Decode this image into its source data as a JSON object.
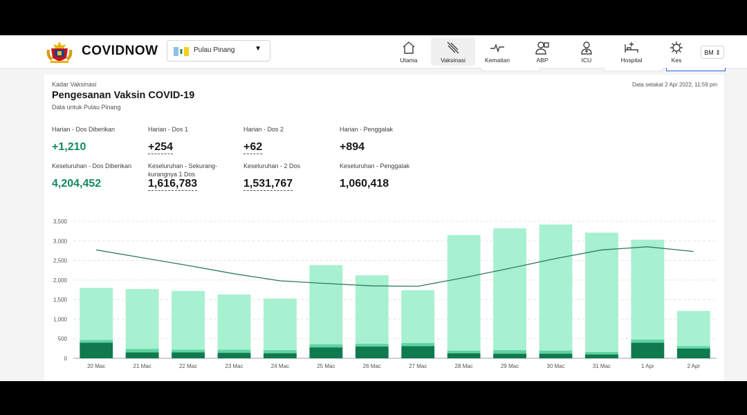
{
  "header": {
    "brand": "COVIDNOW",
    "state_label": "Pulau Pinang",
    "nav": [
      {
        "label": "Utama",
        "icon": "home-icon",
        "active": false
      },
      {
        "label": "Vaksinasi",
        "icon": "syringe-icon",
        "active": true
      },
      {
        "label": "Kematian",
        "icon": "pulse-icon",
        "active": false
      },
      {
        "label": "ABP",
        "icon": "patients-icon",
        "active": false
      },
      {
        "label": "ICU",
        "icon": "icu-icon",
        "active": false
      },
      {
        "label": "Hospital",
        "icon": "hospital-bed-icon",
        "active": false
      },
      {
        "label": "Kes",
        "icon": "virus-icon",
        "active": false
      }
    ],
    "language": "BM ⇕"
  },
  "card": {
    "kicker": "Kadar Vaksinasi",
    "title": "Pengesanan Vaksin COVID-19",
    "subtitle": "Data untuk Pulau Pinang",
    "updated": "Data setakat 2 Apr 2022, 11:59 pm"
  },
  "stats": [
    {
      "daily_label": "Harian - Dos Diberikan",
      "daily_value": "+1,210",
      "total_label": "Keseluruhan - Dos Diberikan",
      "total_value": "4,204,452"
    },
    {
      "daily_label": "Harian - Dos 1",
      "daily_value": "+254",
      "total_label": "Keseluruhan - Sekurang-kurangnya 1 Dos",
      "total_value": "1,616,783"
    },
    {
      "daily_label": "Harian - Dos 2",
      "daily_value": "+62",
      "total_label": "Keseluruhan - 2 Dos",
      "total_value": "1,531,767"
    },
    {
      "daily_label": "Harian - Penggalak",
      "daily_value": "+894",
      "total_label": "Keseluruhan - Penggalak",
      "total_value": "1,060,418"
    }
  ],
  "colors": {
    "accent": "#138a5b",
    "bar_light": "#a7f0d1",
    "bar_mid": "#5fd3a2",
    "bar_dark": "#0f7a4f",
    "line": "#2f7a56"
  },
  "chart_data": {
    "type": "bar",
    "categories": [
      "20 Mac",
      "21 Mac",
      "22 Mac",
      "23 Mac",
      "24 Mac",
      "25 Mac",
      "26 Mac",
      "27 Mac",
      "28 Mac",
      "29 Mac",
      "30 Mac",
      "31 Mac",
      "1 Apr",
      "2 Apr"
    ],
    "stacked": true,
    "series": [
      {
        "values": [
          400,
          150,
          150,
          140,
          130,
          280,
          300,
          310,
          130,
          120,
          120,
          100,
          400,
          250
        ]
      },
      {
        "values": [
          70,
          90,
          70,
          80,
          80,
          80,
          70,
          80,
          70,
          90,
          80,
          60,
          80,
          60
        ]
      },
      {
        "values": [
          1330,
          1530,
          1500,
          1410,
          1320,
          2020,
          1750,
          1350,
          2950,
          3110,
          3220,
          3050,
          2550,
          900
        ]
      },
      {
        "type": "line",
        "values": [
          2770,
          2570,
          2370,
          2160,
          1980,
          1910,
          1850,
          1840,
          2060,
          2300,
          2550,
          2770,
          2850,
          2730
        ]
      }
    ],
    "y_ticks": [
      "0",
      "500",
      "1,000",
      "1,500",
      "2,000",
      "2,500",
      "3,000",
      "3,500"
    ],
    "ylim": [
      0,
      3500
    ],
    "grid": true,
    "legend": "none"
  }
}
